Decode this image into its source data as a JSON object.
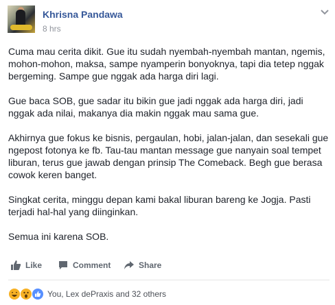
{
  "post": {
    "author": "Khrisna Pandawa",
    "time": "8 hrs",
    "paragraphs": [
      "Cuma mau cerita dikit. Gue itu sudah nyembah-nyembah mantan, ngemis, mohon-mohon, maksa, sampe nyamperin bonyoknya, tapi dia tetep nggak bergeming. Sampe gue nggak ada harga diri lagi.",
      "Gue baca SOB, gue sadar itu bikin gue jadi nggak ada harga diri, jadi nggak ada nilai, makanya dia makin nggak mau sama gue.",
      "Akhirnya gue fokus ke bisnis, pergaulan, hobi, jalan-jalan, dan sesekali gue ngepost fotonya ke fb. Tau-tau mantan message gue nanyain soal tempet liburan, terus gue jawab dengan prinsip The Comeback. Begh gue berasa cowok keren banget.",
      "Singkat cerita, minggu depan kami bakal liburan bareng ke Jogja. Pasti terjadi hal-hal yang diinginkan.",
      "Semua ini karena SOB."
    ]
  },
  "actions": {
    "like": "Like",
    "comment": "Comment",
    "share": "Share"
  },
  "reactions": {
    "icons": [
      "haha-reaction-icon",
      "wow-reaction-icon",
      "like-reaction-icon"
    ],
    "summary": "You, Lex dePraxis and 32 others"
  },
  "colors": {
    "author_link": "#365899",
    "meta_gray": "#90949c",
    "action_gray": "#606770",
    "like_blue": "#5890ff",
    "reaction_yellow": "#f7b125"
  }
}
